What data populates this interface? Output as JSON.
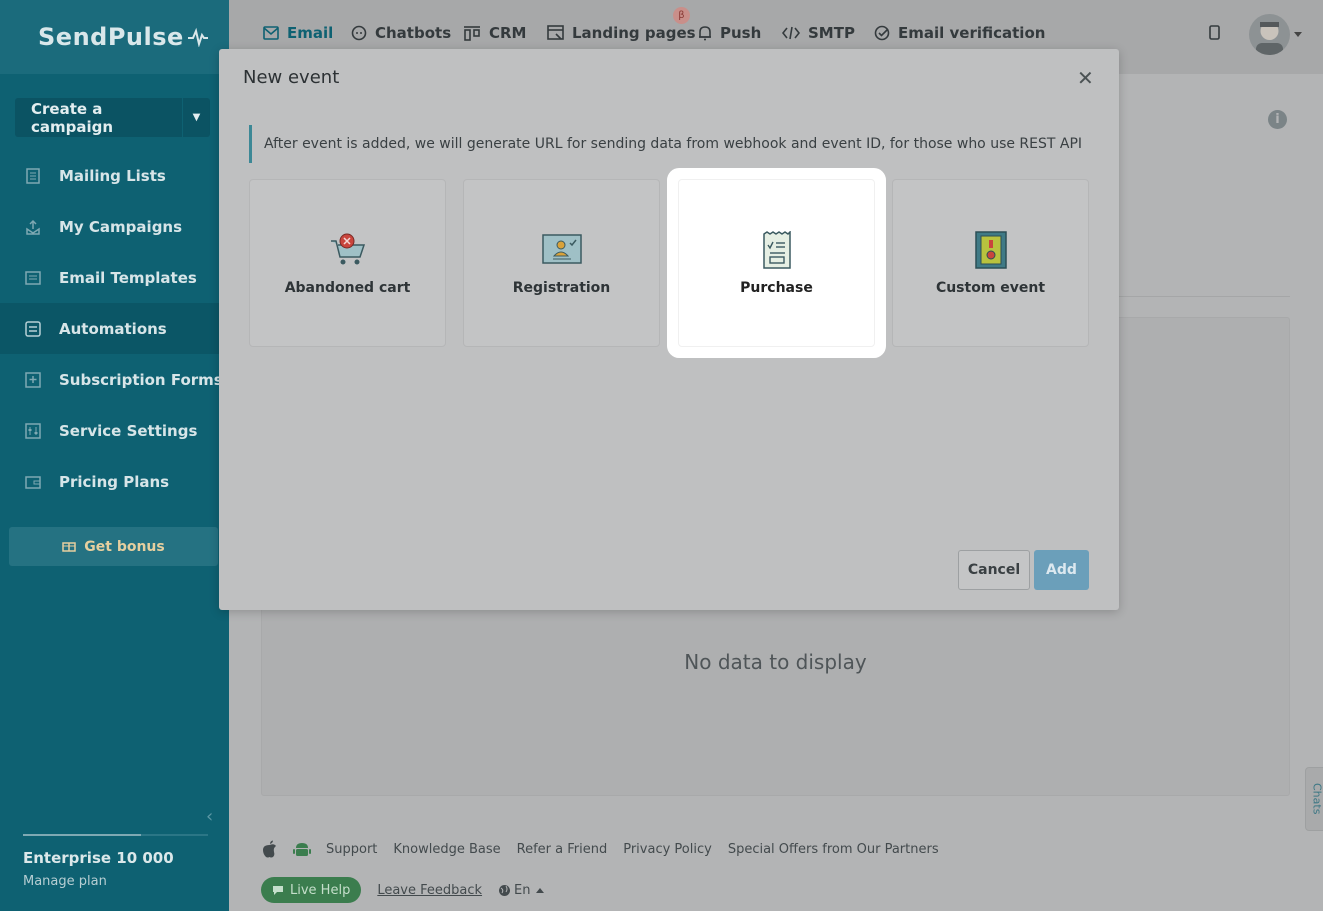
{
  "brand": {
    "name": "SendPulse"
  },
  "sidebar": {
    "create_campaign": "Create a campaign",
    "items": [
      {
        "label": "Mailing Lists",
        "icon": "list-icon"
      },
      {
        "label": "My Campaigns",
        "icon": "campaigns-icon"
      },
      {
        "label": "Email Templates",
        "icon": "templates-icon"
      },
      {
        "label": "Automations",
        "icon": "automations-icon",
        "active": true
      },
      {
        "label": "Subscription Forms",
        "icon": "forms-icon"
      },
      {
        "label": "Service Settings",
        "icon": "settings-icon"
      },
      {
        "label": "Pricing Plans",
        "icon": "wallet-icon"
      }
    ],
    "bonus": "Get bonus",
    "plan_name": "Enterprise 10 000",
    "manage_plan": "Manage plan"
  },
  "topnav": {
    "items": [
      {
        "label": "Email",
        "icon": "mail-icon",
        "active": true
      },
      {
        "label": "Chatbots",
        "icon": "chat-icon"
      },
      {
        "label": "CRM",
        "icon": "crm-icon"
      },
      {
        "label": "Landing pages",
        "icon": "landing-icon"
      },
      {
        "label": "Push",
        "icon": "bell-icon"
      },
      {
        "label": "SMTP",
        "icon": "code-icon"
      },
      {
        "label": "Email verification",
        "icon": "verify-icon"
      }
    ],
    "beta_badge": "β"
  },
  "main": {
    "no_data": "No data to display",
    "chats_tab": "Chats"
  },
  "footer": {
    "links": [
      "Support",
      "Knowledge Base",
      "Refer a Friend",
      "Privacy Policy",
      "Special Offers from Our Partners"
    ],
    "live_help": "Live Help",
    "feedback": "Leave Feedback",
    "language": "En"
  },
  "modal": {
    "title": "New event",
    "notice": "After event is added, we will generate URL for sending data from webhook and event ID, for those who use REST API",
    "cards": [
      {
        "label": "Abandoned cart",
        "icon": "cart-icon"
      },
      {
        "label": "Registration",
        "icon": "registration-icon"
      },
      {
        "label": "Purchase",
        "icon": "receipt-icon",
        "highlighted": true
      },
      {
        "label": "Custom event",
        "icon": "custom-event-icon"
      }
    ],
    "cancel": "Cancel",
    "add": "Add"
  },
  "colors": {
    "sidebar_bg": "#0e6172",
    "accent": "#0e6172",
    "add_button": "#6b9fba",
    "live_help": "#3b7d4e"
  }
}
